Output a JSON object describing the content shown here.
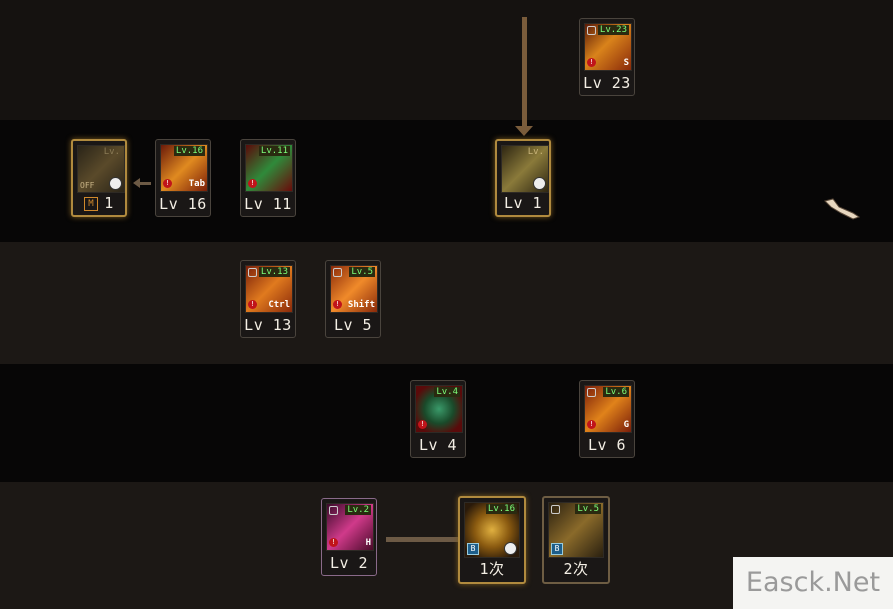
{
  "skills": [
    {
      "id": "lv23",
      "badge": "Lv.23",
      "key": "S",
      "level_label": "Lv 23"
    },
    {
      "id": "m1",
      "badge": "Lv.",
      "off": "OFF",
      "level_label": "1",
      "mtag": "M"
    },
    {
      "id": "lv16",
      "badge": "Lv.16",
      "key": "Tab",
      "level_label": "Lv 16"
    },
    {
      "id": "lv11",
      "badge": "Lv.11",
      "level_label": "Lv 11"
    },
    {
      "id": "lv1",
      "badge": "Lv.",
      "level_label": "Lv 1"
    },
    {
      "id": "lv13",
      "badge": "Lv.13",
      "key": "Ctrl",
      "level_label": "Lv 13"
    },
    {
      "id": "lv5",
      "badge": "Lv.5",
      "key": "Shift",
      "level_label": "Lv 5"
    },
    {
      "id": "lv4",
      "badge": "Lv.4",
      "level_label": "Lv 4"
    },
    {
      "id": "lv6",
      "badge": "Lv.6",
      "key": "G",
      "level_label": "Lv 6"
    },
    {
      "id": "lv2",
      "badge": "Lv.2",
      "key": "H",
      "level_label": "Lv 2"
    },
    {
      "id": "first",
      "badge": "Lv.16",
      "blue": "B",
      "level_label": "1次"
    },
    {
      "id": "second",
      "badge": "Lv.5",
      "blue": "B",
      "level_label": "2次"
    }
  ],
  "watermark": "Easck.Net",
  "colors": {
    "background": "#0b0908",
    "level_text": "#f4efe5",
    "badge_green": "#7dff7a",
    "warning_red": "#c0141a",
    "connector": "#7a5c3b"
  }
}
